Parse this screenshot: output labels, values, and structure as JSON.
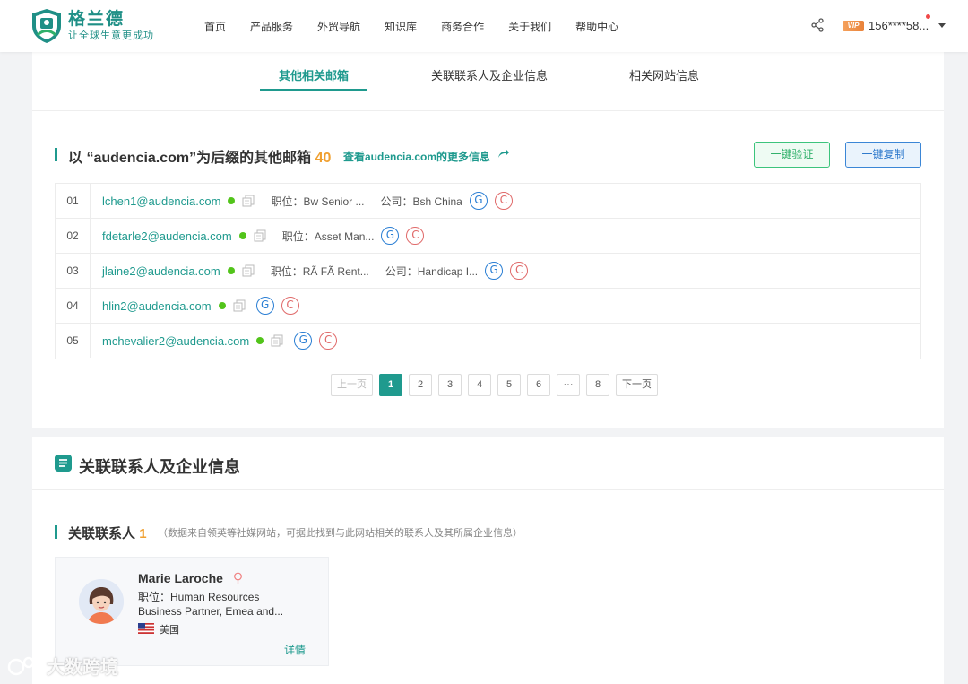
{
  "header": {
    "logo_title": "格兰德",
    "logo_subtitle": "让全球生意更成功",
    "nav": [
      "首页",
      "产品服务",
      "外贸导航",
      "知识库",
      "商务合作",
      "关于我们",
      "帮助中心"
    ],
    "vip_label": "VIP",
    "user_phone": "156****58..."
  },
  "tabs": [
    "其他相关邮箱",
    "关联联系人及企业信息",
    "相关网站信息"
  ],
  "emails_section": {
    "title_prefix": "以 “audencia.com”为后缀的其他邮箱",
    "count": "40",
    "more_link": "查看audencia.com的更多信息",
    "verify_button": "一键验证",
    "copy_button": "一键复制",
    "rows": [
      {
        "idx": "01",
        "email": "lchen1@audencia.com",
        "job": "职位：Bw Senior ...",
        "company": "公司：Bsh China"
      },
      {
        "idx": "02",
        "email": "fdetarle2@audencia.com",
        "job": "职位：Asset Man...",
        "company": ""
      },
      {
        "idx": "03",
        "email": "jlaine2@audencia.com",
        "job": "职位：RÃ FÃ Rent...",
        "company": "公司：Handicap I..."
      },
      {
        "idx": "04",
        "email": "hlin2@audencia.com",
        "job": "",
        "company": ""
      },
      {
        "idx": "05",
        "email": "mchevalier2@audencia.com",
        "job": "",
        "company": ""
      }
    ],
    "badge_g": "G",
    "badge_c": "C"
  },
  "pagination": {
    "prev": "上一页",
    "pages": [
      "1",
      "2",
      "3",
      "4",
      "5",
      "6",
      "···",
      "8"
    ],
    "current": "1",
    "next": "下一页"
  },
  "contacts_section": {
    "title": "关联联系人及企业信息",
    "sub_title": "关联联系人",
    "sub_count": "1",
    "note": "（数据来自领英等社媒网站，可据此找到与此网站相关的联系人及其所属企业信息）",
    "contact": {
      "name": "Marie Laroche",
      "job_line1": "职位：Human Resources",
      "job_line2": "Business Partner, Emea and...",
      "country": "美国",
      "detail": "详情"
    }
  },
  "watermark": "大数跨境",
  "colors": {
    "accent": "#1f9a8e",
    "count": "#f0a030",
    "verify": "#2fb06a",
    "copy": "#2d79cc"
  }
}
